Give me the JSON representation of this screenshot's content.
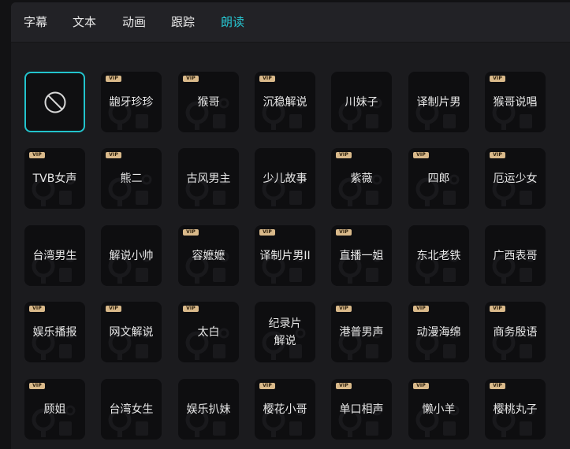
{
  "tabs": [
    {
      "label": "字幕",
      "active": false
    },
    {
      "label": "文本",
      "active": false
    },
    {
      "label": "动画",
      "active": false
    },
    {
      "label": "跟踪",
      "active": false
    },
    {
      "label": "朗读",
      "active": true
    }
  ],
  "accent_color": "#27c6d1",
  "vip_badge": "VIP",
  "voices": [
    {
      "label": "",
      "vip": false,
      "none": true,
      "icon": "no-voice-icon",
      "selected": true
    },
    {
      "label": "龅牙珍珍",
      "vip": true
    },
    {
      "label": "猴哥",
      "vip": true
    },
    {
      "label": "沉稳解说",
      "vip": true
    },
    {
      "label": "川妹子",
      "vip": false
    },
    {
      "label": "译制片男",
      "vip": false
    },
    {
      "label": "猴哥说唱",
      "vip": true
    },
    {
      "label": "TVB女声",
      "vip": true
    },
    {
      "label": "熊二",
      "vip": true
    },
    {
      "label": "古风男主",
      "vip": false
    },
    {
      "label": "少儿故事",
      "vip": false
    },
    {
      "label": "紫薇",
      "vip": true
    },
    {
      "label": "四郎",
      "vip": true
    },
    {
      "label": "厄运少女",
      "vip": true
    },
    {
      "label": "台湾男生",
      "vip": false
    },
    {
      "label": "解说小帅",
      "vip": false
    },
    {
      "label": "容嬷嬷",
      "vip": true
    },
    {
      "label": "译制片男II",
      "vip": true
    },
    {
      "label": "直播一姐",
      "vip": true
    },
    {
      "label": "东北老铁",
      "vip": false
    },
    {
      "label": "广西表哥",
      "vip": false
    },
    {
      "label": "娱乐播报",
      "vip": true
    },
    {
      "label": "网文解说",
      "vip": true
    },
    {
      "label": "太白",
      "vip": true
    },
    {
      "label": "纪录片\n解说",
      "vip": false
    },
    {
      "label": "港普男声",
      "vip": true
    },
    {
      "label": "动漫海绵",
      "vip": true
    },
    {
      "label": "商务殷语",
      "vip": true
    },
    {
      "label": "顾姐",
      "vip": true
    },
    {
      "label": "台湾女生",
      "vip": false
    },
    {
      "label": "娱乐扒妹",
      "vip": false
    },
    {
      "label": "樱花小哥",
      "vip": true
    },
    {
      "label": "单口相声",
      "vip": true
    },
    {
      "label": "懒小羊",
      "vip": true
    },
    {
      "label": "樱桃丸子",
      "vip": true
    }
  ]
}
